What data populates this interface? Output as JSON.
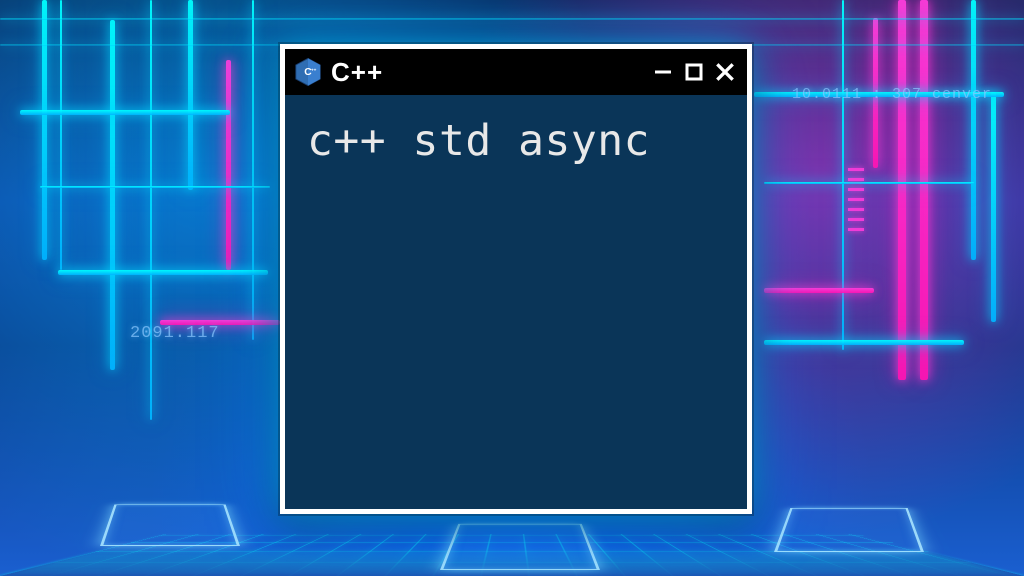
{
  "window": {
    "title": "C++",
    "content": "c++ std async"
  },
  "decorative_text": {
    "left_numbers": "2091.117",
    "right_text": "10.0111 : 307  cenver"
  },
  "colors": {
    "window_bg": "#0a3558",
    "window_border": "#ffffff",
    "titlebar_bg": "#000000",
    "neon_cyan": "#00e5ff",
    "neon_magenta": "#ff34d8"
  }
}
